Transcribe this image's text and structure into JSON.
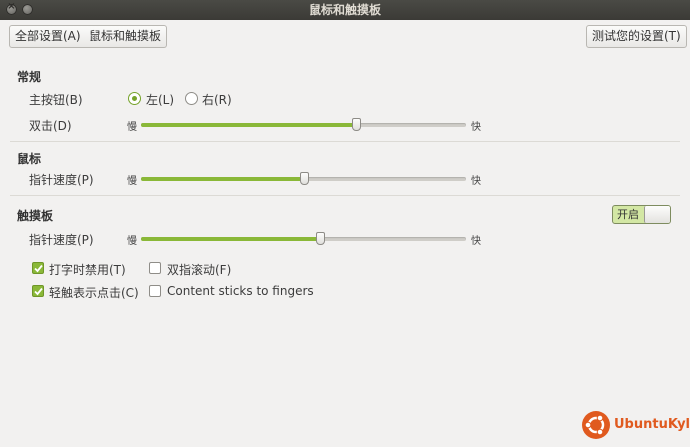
{
  "window": {
    "title": "鼠标和触摸板"
  },
  "toolbar": {
    "all_settings_label": "全部设置(A)",
    "breadcrumb_label": "鼠标和触摸板",
    "test_settings_label": "测试您的设置(T)"
  },
  "general": {
    "heading": "常规",
    "primary_button_label": "主按钮(B)",
    "left_option": "左(L)",
    "right_option": "右(R)",
    "selected": "左(L)",
    "double_click_label": "双击(D)",
    "double_click_value": 0.66,
    "slow": "慢",
    "fast": "快"
  },
  "mouse": {
    "heading": "鼠标",
    "pointer_speed_label": "指针速度(P)",
    "pointer_speed_value": 0.5,
    "slow": "慢",
    "fast": "快"
  },
  "touchpad": {
    "heading": "触摸板",
    "switch_label": "开启",
    "switch_on": true,
    "pointer_speed_label": "指针速度(P)",
    "pointer_speed_value": 0.55,
    "slow": "慢",
    "fast": "快",
    "disable_while_typing": {
      "label": "打字时禁用(T)",
      "checked": true
    },
    "two_finger_scroll": {
      "label": "双指滚动(F)",
      "checked": false
    },
    "tap_to_click": {
      "label": "轻触表示点击(C)",
      "checked": true
    },
    "content_sticks": {
      "label": "Content sticks to fingers",
      "checked": false
    }
  },
  "branding": {
    "logo_text": "UbuntuKylin",
    "accent_color": "#e05a1f"
  },
  "colors": {
    "slider_fill": "#8ab838",
    "titlebar": "#3c3b37"
  }
}
